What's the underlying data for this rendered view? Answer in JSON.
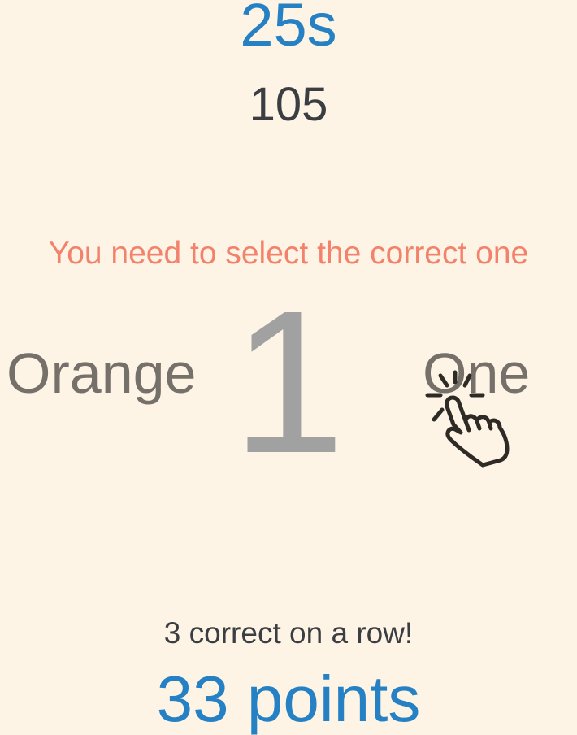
{
  "timer": "25s",
  "score": "105",
  "instruction": "You need to select the correct one",
  "big_digit": "1",
  "options": {
    "left": "Orange",
    "right": "One"
  },
  "streak": "3 correct on a row!",
  "points": "33 points",
  "colors": {
    "background": "#fdf4e5",
    "accent_blue": "#2581c4",
    "instruction_coral": "#f3826c",
    "dark_text": "#3a3d41",
    "option_text": "#76706a",
    "digit_gray": "#a1a1a1"
  },
  "icons": {
    "hint_cursor": "tap-hand-icon"
  }
}
